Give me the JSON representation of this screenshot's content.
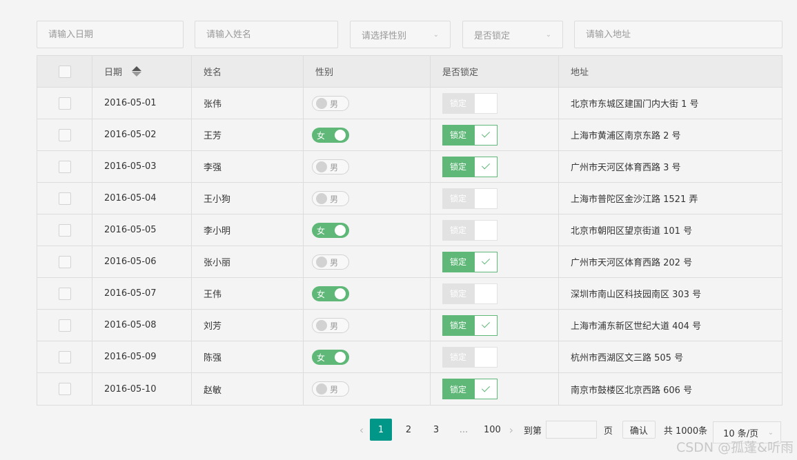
{
  "filters": {
    "date_placeholder": "请输入日期",
    "name_placeholder": "请输入姓名",
    "gender_placeholder": "请选择性别",
    "lock_placeholder": "是否锁定",
    "address_placeholder": "请输入地址"
  },
  "table": {
    "headers": {
      "date": "日期",
      "name": "姓名",
      "gender": "性别",
      "locked": "是否锁定",
      "address": "地址"
    },
    "rows": [
      {
        "date": "2016-05-01",
        "name": "张伟",
        "gender": "男",
        "gender_on": false,
        "lock_label": "锁定",
        "locked": false,
        "address": "北京市东城区建国门内大街 1 号"
      },
      {
        "date": "2016-05-02",
        "name": "王芳",
        "gender": "女",
        "gender_on": true,
        "lock_label": "锁定",
        "locked": true,
        "address": "上海市黄浦区南京东路 2 号"
      },
      {
        "date": "2016-05-03",
        "name": "李强",
        "gender": "男",
        "gender_on": false,
        "lock_label": "锁定",
        "locked": true,
        "address": "广州市天河区体育西路 3 号"
      },
      {
        "date": "2016-05-04",
        "name": "王小狗",
        "gender": "男",
        "gender_on": false,
        "lock_label": "锁定",
        "locked": false,
        "address": "上海市普陀区金沙江路 1521 弄"
      },
      {
        "date": "2016-05-05",
        "name": "李小明",
        "gender": "女",
        "gender_on": true,
        "lock_label": "锁定",
        "locked": false,
        "address": "北京市朝阳区望京街道 101 号"
      },
      {
        "date": "2016-05-06",
        "name": "张小丽",
        "gender": "男",
        "gender_on": false,
        "lock_label": "锁定",
        "locked": true,
        "address": "广州市天河区体育西路 202 号"
      },
      {
        "date": "2016-05-07",
        "name": "王伟",
        "gender": "女",
        "gender_on": true,
        "lock_label": "锁定",
        "locked": false,
        "address": "深圳市南山区科技园南区 303 号"
      },
      {
        "date": "2016-05-08",
        "name": "刘芳",
        "gender": "男",
        "gender_on": false,
        "lock_label": "锁定",
        "locked": true,
        "address": "上海市浦东新区世纪大道 404 号"
      },
      {
        "date": "2016-05-09",
        "name": "陈强",
        "gender": "女",
        "gender_on": true,
        "lock_label": "锁定",
        "locked": false,
        "address": "杭州市西湖区文三路 505 号"
      },
      {
        "date": "2016-05-10",
        "name": "赵敏",
        "gender": "男",
        "gender_on": false,
        "lock_label": "锁定",
        "locked": true,
        "address": "南京市鼓楼区北京西路 606 号"
      }
    ]
  },
  "pager": {
    "pages": [
      "1",
      "2",
      "3"
    ],
    "ellipsis": "...",
    "last_page": "100",
    "current_page": "1",
    "goto_label": "到第",
    "page_unit": "页",
    "confirm_label": "确认",
    "total_label": "共 1000条",
    "limit_label": "10 条/页"
  },
  "watermark": "CSDN @孤蓬&听雨",
  "colors": {
    "accent_green": "#5fb878",
    "current_page": "#009688",
    "disabled_lock": "#e2e2e2"
  }
}
